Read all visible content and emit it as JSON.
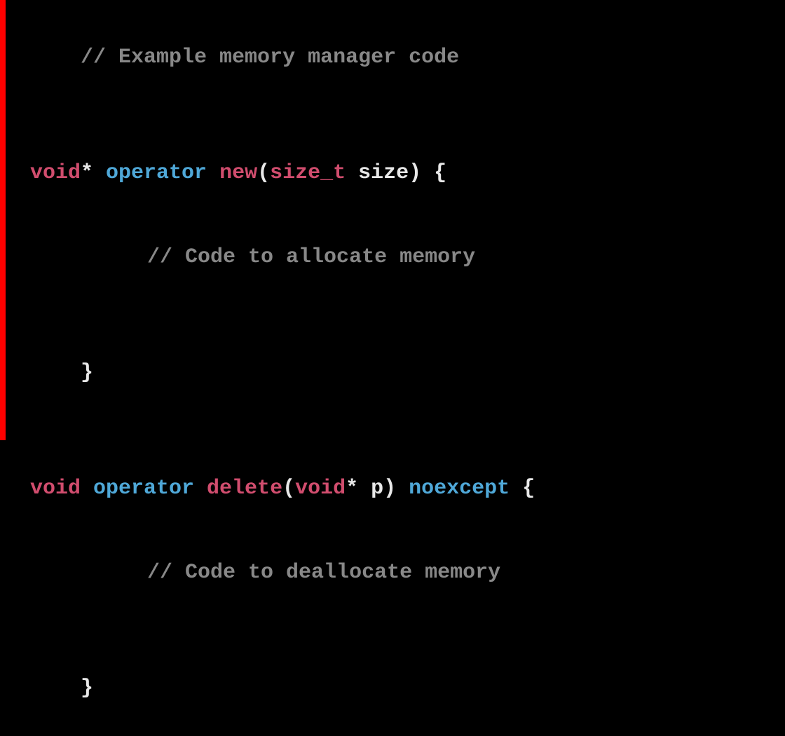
{
  "code": {
    "line1_comment": "// Example memory manager code",
    "line2_void": "void",
    "line2_star": "*",
    "line2_operator": " operator",
    "line2_new": " new",
    "line2_paren_open": "(",
    "line2_sizet": "size_t",
    "line2_param": " size",
    "line2_paren_close": ")",
    "line2_brace": " {",
    "line3_comment": "// Code to allocate memory",
    "line4_brace": "}",
    "line5_void": "void",
    "line5_operator": " operator",
    "line5_delete": " delete",
    "line5_paren_open": "(",
    "line5_voidp": "void",
    "line5_star": "*",
    "line5_param": " p",
    "line5_paren_close": ")",
    "line5_noexcept": " noexcept",
    "line5_brace": " {",
    "line6_comment": "// Code to deallocate memory",
    "line7_brace": "}"
  }
}
